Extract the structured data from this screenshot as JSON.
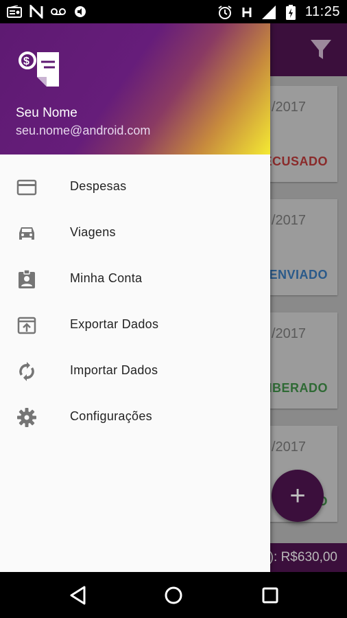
{
  "status_bar": {
    "time": "11:25",
    "left_icons": [
      "radio-icon",
      "notification-n-icon",
      "voicemail-icon",
      "mute-icon"
    ],
    "right_icons": [
      "alarm-icon",
      "network-h-icon",
      "signal-icon",
      "battery-charging-icon"
    ]
  },
  "background_app": {
    "toolbar_color": "#3b0f3c",
    "cards": [
      {
        "date": "/2017",
        "status": "ECUSADO",
        "status_color": "#e02424"
      },
      {
        "date": "/2017",
        "status": "ENVIADO",
        "status_color": "#1e6fd0"
      },
      {
        "date": "/2017",
        "status": "IBERADO",
        "status_color": "#2e9a38"
      },
      {
        "date": "/2017",
        "status": "O",
        "status_color": "#2e9a38"
      }
    ],
    "footer_total": "): R$630,00",
    "fab_label": "+"
  },
  "drawer": {
    "header": {
      "name": "Seu Nome",
      "email": "seu.nome@android.com"
    },
    "items": [
      {
        "label": "Despesas",
        "icon": "credit-card-icon"
      },
      {
        "label": "Viagens",
        "icon": "car-icon"
      },
      {
        "label": "Minha Conta",
        "icon": "account-badge-icon"
      },
      {
        "label": "Exportar Dados",
        "icon": "export-icon"
      },
      {
        "label": "Importar Dados",
        "icon": "sync-icon"
      },
      {
        "label": "Configurações",
        "icon": "settings-gear-icon"
      }
    ]
  },
  "nav_bar": {
    "buttons": [
      "back-icon",
      "home-icon",
      "recents-icon"
    ]
  }
}
